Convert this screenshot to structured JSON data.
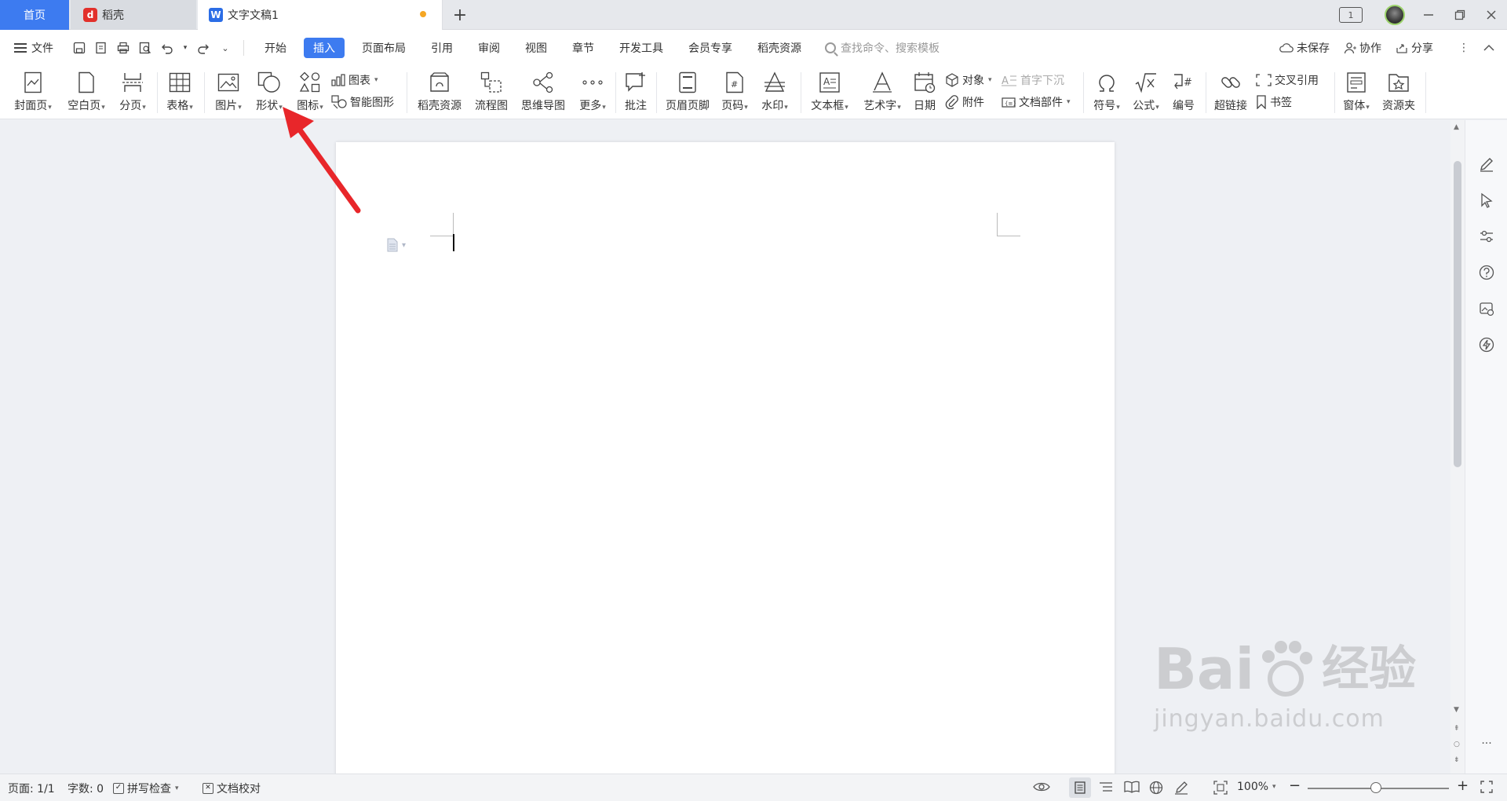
{
  "tabs": {
    "home": "首页",
    "daoke": "稻壳",
    "doc": "文字文稿1"
  },
  "menubar": {
    "file": "文件",
    "tabs": [
      "开始",
      "插入",
      "页面布局",
      "引用",
      "审阅",
      "视图",
      "章节",
      "开发工具",
      "会员专享",
      "稻壳资源"
    ],
    "active_tab": "插入",
    "search_placeholder": "查找命令、搜索模板",
    "unsaved": "未保存",
    "collab": "协作",
    "share": "分享"
  },
  "ribbon": {
    "cover": "封面页",
    "blank": "空白页",
    "pagebreak": "分页",
    "table": "表格",
    "picture": "图片",
    "shape": "形状",
    "icon": "图标",
    "chart": "图表",
    "smartart": "智能图形",
    "daoke_res": "稻壳资源",
    "flowchart": "流程图",
    "mindmap": "思维导图",
    "more": "更多",
    "comment": "批注",
    "header_footer": "页眉页脚",
    "page_number": "页码",
    "watermark": "水印",
    "textbox": "文本框",
    "wordart": "艺术字",
    "date": "日期",
    "object": "对象",
    "attachment": "附件",
    "dropcap": "首字下沉",
    "docparts": "文档部件",
    "symbol": "符号",
    "formula": "公式",
    "numbering": "编号",
    "hyperlink": "超链接",
    "crossref": "交叉引用",
    "bookmark": "书签",
    "window": "窗体",
    "resource": "资源夹"
  },
  "status": {
    "page": "页面: 1/1",
    "words": "字数: 0",
    "spell": "拼写检查",
    "proof": "文档校对",
    "zoom": "100%"
  },
  "watermark": {
    "brand": "Bai",
    "brand2": "经验",
    "url": "jingyan.baidu.com"
  },
  "colors": {
    "accent": "#3d7bf0",
    "arrow": "#e8262a"
  }
}
